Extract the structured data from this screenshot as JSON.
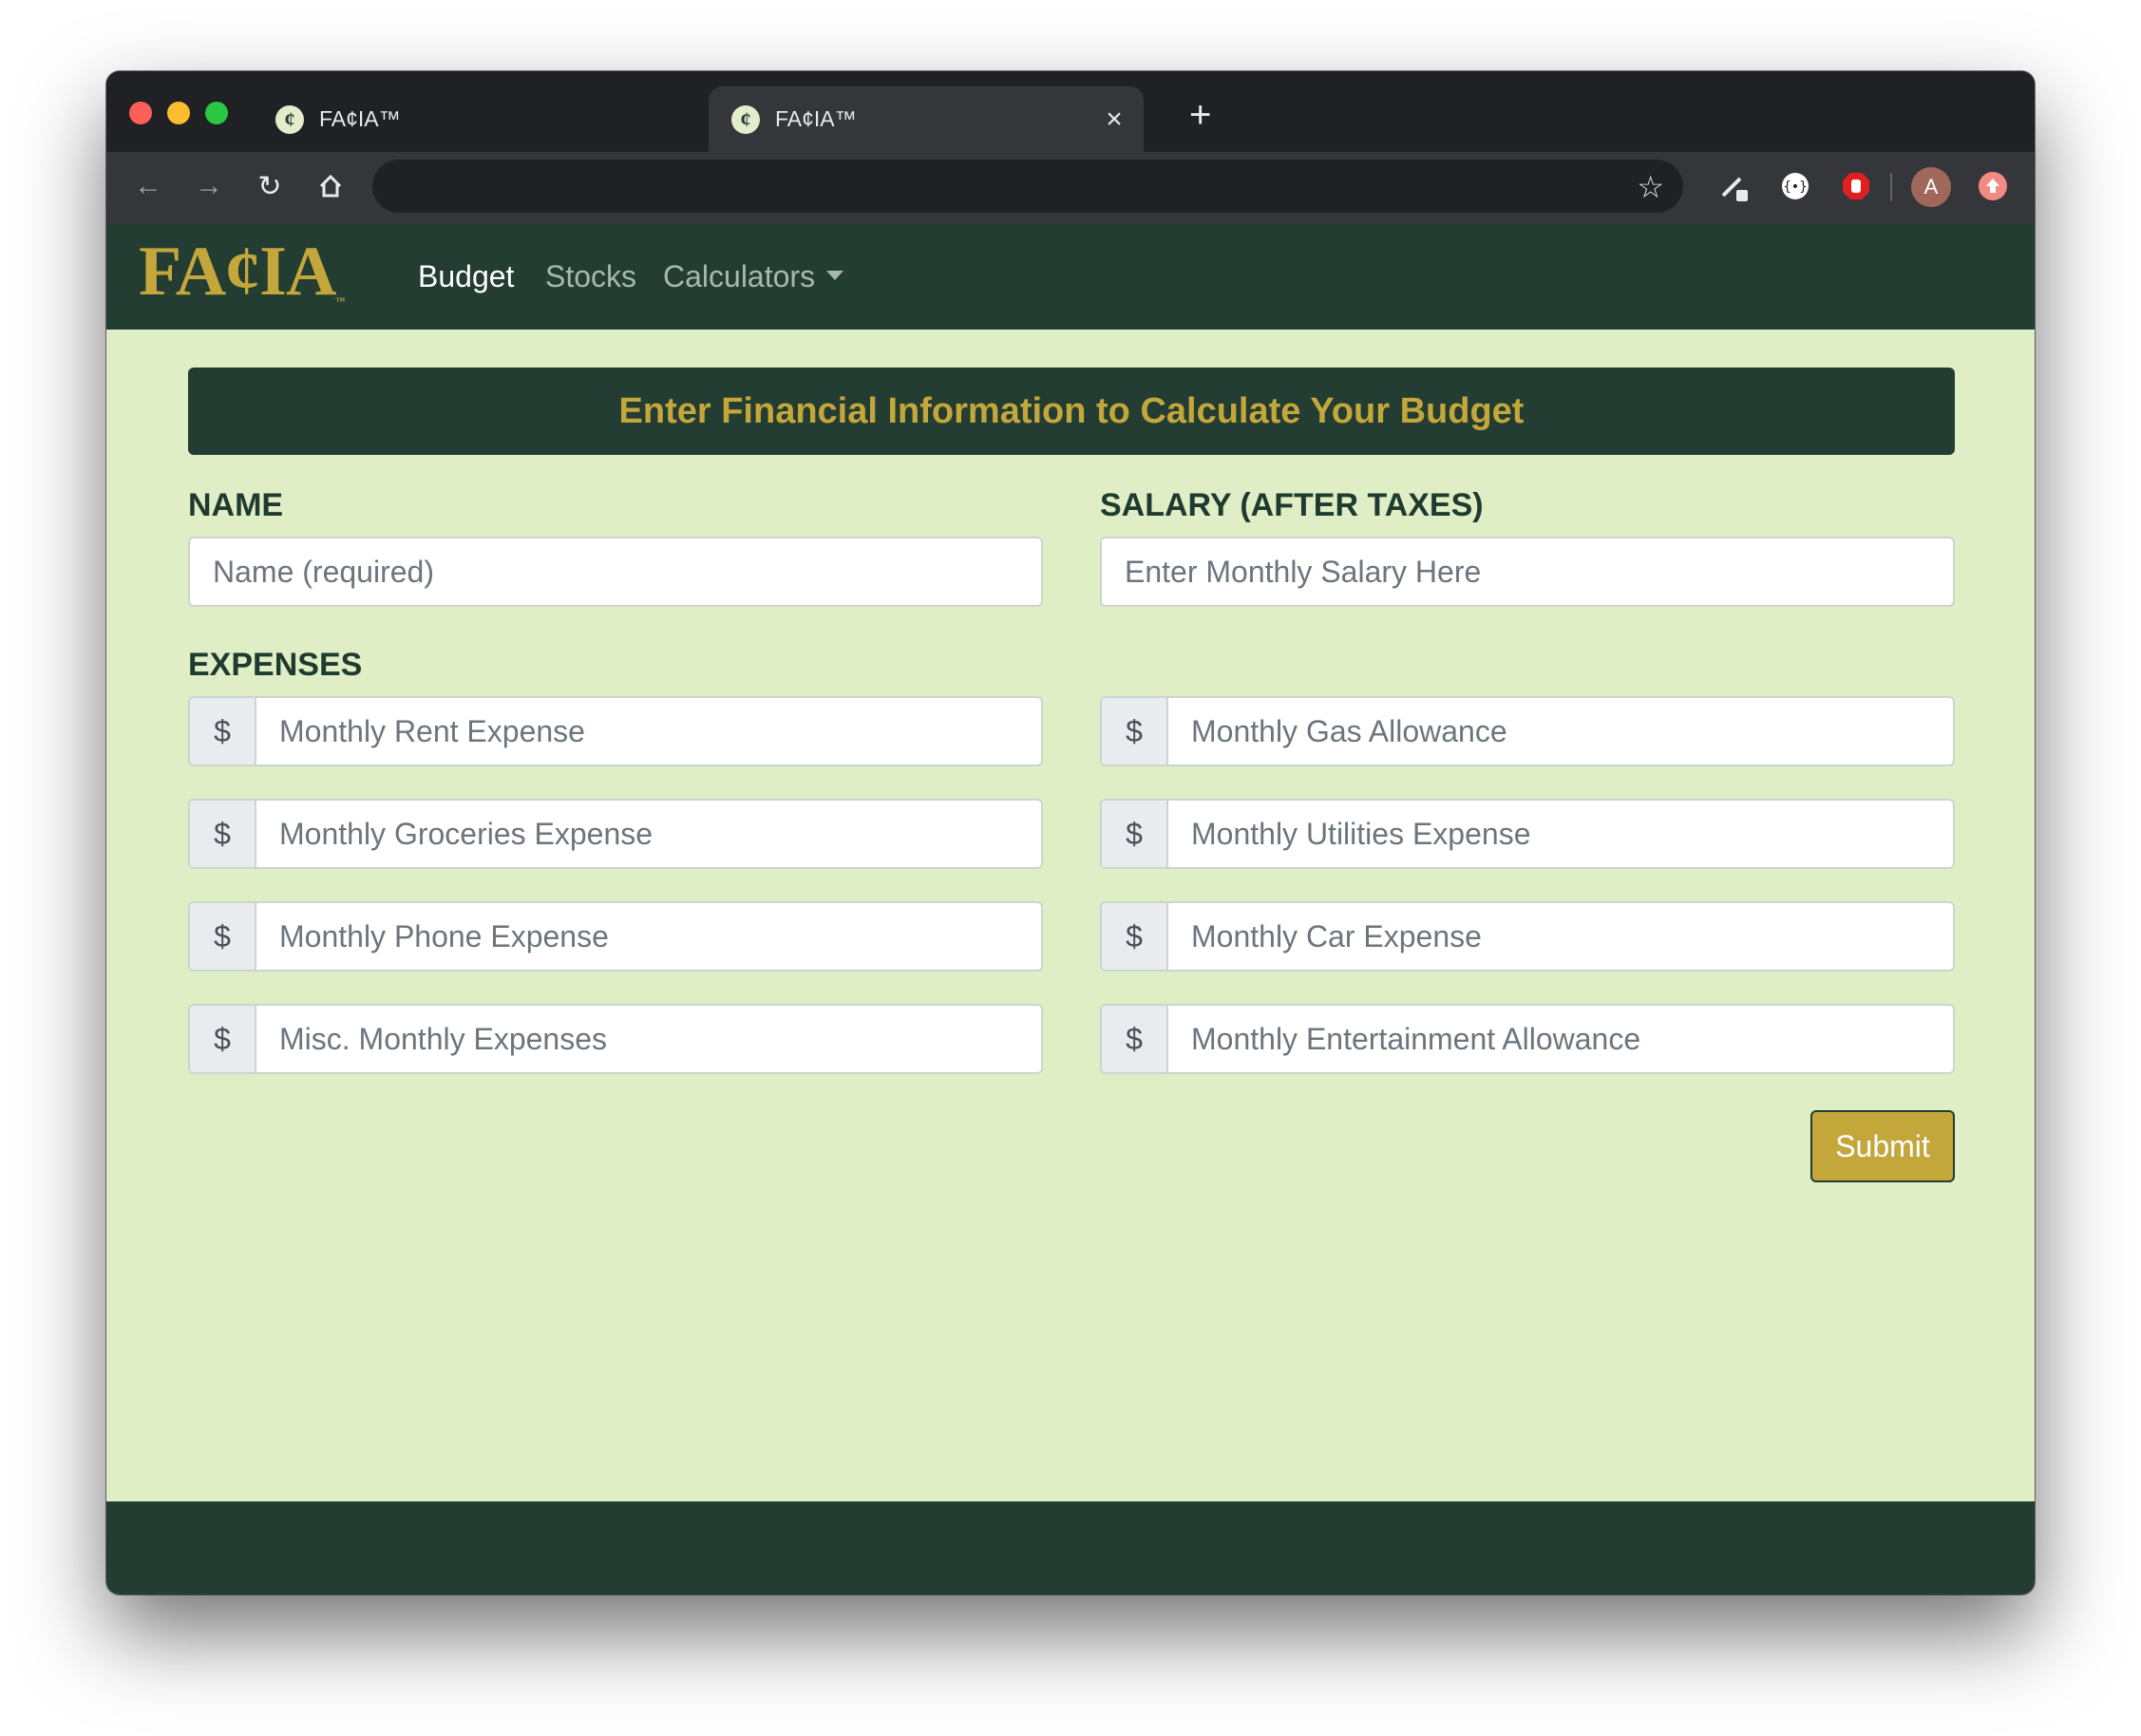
{
  "browser": {
    "tabs": [
      {
        "title": "FA¢IA™"
      },
      {
        "title": "FA¢IA™"
      }
    ],
    "favicon_glyph": "¢",
    "avatar_initial": "A",
    "traffic_colors": [
      "#fe5f57",
      "#febc2e",
      "#28c840"
    ]
  },
  "navbar": {
    "logo": "FA¢IA",
    "logo_tm": "™",
    "links": [
      {
        "label": "Budget",
        "active": true
      },
      {
        "label": "Stocks",
        "active": false
      },
      {
        "label": "Calculators",
        "active": false,
        "dropdown": true
      }
    ]
  },
  "form": {
    "banner": "Enter Financial Information to Calculate Your Budget",
    "name_label": "NAME",
    "name_placeholder": "Name (required)",
    "salary_label": "SALARY (AFTER TAXES)",
    "salary_placeholder": "Enter Monthly Salary Here",
    "expenses_label": "EXPENSES",
    "currency": "$",
    "expenses": [
      {
        "placeholder": "Monthly Rent Expense"
      },
      {
        "placeholder": "Monthly Gas Allowance"
      },
      {
        "placeholder": "Monthly Groceries Expense"
      },
      {
        "placeholder": "Monthly Utilities Expense"
      },
      {
        "placeholder": "Monthly Phone Expense"
      },
      {
        "placeholder": "Monthly Car Expense"
      },
      {
        "placeholder": "Misc. Monthly Expenses"
      },
      {
        "placeholder": "Monthly Entertainment Allowance"
      }
    ],
    "submit_label": "Submit"
  },
  "colors": {
    "brand_dark": "#233d33",
    "brand_gold": "#c4a73a",
    "page_bg": "#dfeec5"
  }
}
